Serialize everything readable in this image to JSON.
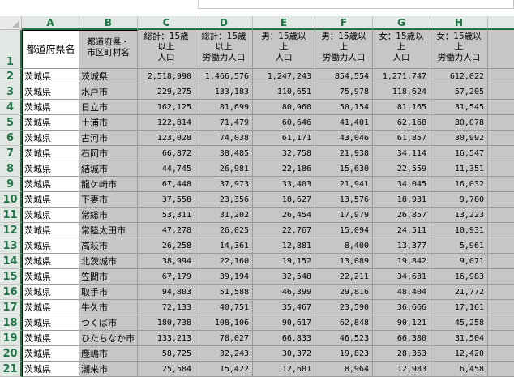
{
  "columns": [
    "A",
    "B",
    "C",
    "D",
    "E",
    "F",
    "G",
    "H"
  ],
  "header_row_number": "1",
  "headers": {
    "A": [
      "都道府県名"
    ],
    "B": [
      "都道府県・",
      "市区町村名"
    ],
    "C": [
      "総計：15歳",
      "以上",
      "人口"
    ],
    "D": [
      "総計：15歳",
      "以上",
      "労働力人口"
    ],
    "E": [
      "男：15歳以",
      "上",
      "人口"
    ],
    "F": [
      "男：15歳以",
      "上",
      "労働力人口"
    ],
    "G": [
      "女：15歳以",
      "上",
      "人口"
    ],
    "H": [
      "女：15歳以",
      "上",
      "労働力人口"
    ]
  },
  "rows": [
    {
      "n": "2",
      "a": "茨城県",
      "b": "茨城県",
      "v": [
        "2,518,990",
        "1,466,576",
        "1,247,243",
        "854,554",
        "1,271,747",
        "612,022"
      ]
    },
    {
      "n": "3",
      "a": "茨城県",
      "b": "水戸市",
      "v": [
        "229,275",
        "133,183",
        "110,651",
        "75,978",
        "118,624",
        "57,205"
      ]
    },
    {
      "n": "4",
      "a": "茨城県",
      "b": "日立市",
      "v": [
        "162,125",
        "81,699",
        "80,960",
        "50,154",
        "81,165",
        "31,545"
      ]
    },
    {
      "n": "5",
      "a": "茨城県",
      "b": "土浦市",
      "v": [
        "122,814",
        "71,479",
        "60,646",
        "41,401",
        "62,168",
        "30,078"
      ]
    },
    {
      "n": "6",
      "a": "茨城県",
      "b": "古河市",
      "v": [
        "123,028",
        "74,038",
        "61,171",
        "43,046",
        "61,857",
        "30,992"
      ]
    },
    {
      "n": "7",
      "a": "茨城県",
      "b": "石岡市",
      "v": [
        "66,872",
        "38,485",
        "32,758",
        "21,938",
        "34,114",
        "16,547"
      ]
    },
    {
      "n": "8",
      "a": "茨城県",
      "b": "結城市",
      "v": [
        "44,745",
        "26,981",
        "22,186",
        "15,630",
        "22,559",
        "11,351"
      ]
    },
    {
      "n": "9",
      "a": "茨城県",
      "b": "龍ケ崎市",
      "v": [
        "67,448",
        "37,973",
        "33,403",
        "21,941",
        "34,045",
        "16,032"
      ]
    },
    {
      "n": "10",
      "a": "茨城県",
      "b": "下妻市",
      "v": [
        "37,558",
        "23,356",
        "18,627",
        "13,576",
        "18,931",
        "9,780"
      ]
    },
    {
      "n": "11",
      "a": "茨城県",
      "b": "常総市",
      "v": [
        "53,311",
        "31,202",
        "26,454",
        "17,979",
        "26,857",
        "13,223"
      ]
    },
    {
      "n": "12",
      "a": "茨城県",
      "b": "常陸太田市",
      "v": [
        "47,278",
        "26,025",
        "22,767",
        "15,094",
        "24,511",
        "10,931"
      ]
    },
    {
      "n": "13",
      "a": "茨城県",
      "b": "高萩市",
      "v": [
        "26,258",
        "14,361",
        "12,881",
        "8,400",
        "13,377",
        "5,961"
      ]
    },
    {
      "n": "14",
      "a": "茨城県",
      "b": "北茨城市",
      "v": [
        "38,994",
        "22,160",
        "19,152",
        "13,089",
        "19,842",
        "9,071"
      ]
    },
    {
      "n": "15",
      "a": "茨城県",
      "b": "笠間市",
      "v": [
        "67,179",
        "39,194",
        "32,548",
        "22,211",
        "34,631",
        "16,983"
      ]
    },
    {
      "n": "16",
      "a": "茨城県",
      "b": "取手市",
      "v": [
        "94,803",
        "51,588",
        "46,399",
        "29,816",
        "48,404",
        "21,772"
      ]
    },
    {
      "n": "17",
      "a": "茨城県",
      "b": "牛久市",
      "v": [
        "72,133",
        "40,751",
        "35,467",
        "23,590",
        "36,666",
        "17,161"
      ]
    },
    {
      "n": "18",
      "a": "茨城県",
      "b": "つくば市",
      "v": [
        "180,738",
        "108,106",
        "90,617",
        "62,848",
        "90,121",
        "45,258"
      ]
    },
    {
      "n": "19",
      "a": "茨城県",
      "b": "ひたちなか市",
      "v": [
        "133,213",
        "78,027",
        "66,833",
        "46,523",
        "66,380",
        "31,504"
      ]
    },
    {
      "n": "20",
      "a": "茨城県",
      "b": "鹿嶋市",
      "v": [
        "58,725",
        "32,243",
        "30,372",
        "19,823",
        "28,353",
        "12,420"
      ]
    },
    {
      "n": "21",
      "a": "茨城県",
      "b": "潮来市",
      "v": [
        "25,584",
        "15,422",
        "12,601",
        "8,964",
        "12,983",
        "6,458"
      ]
    }
  ]
}
